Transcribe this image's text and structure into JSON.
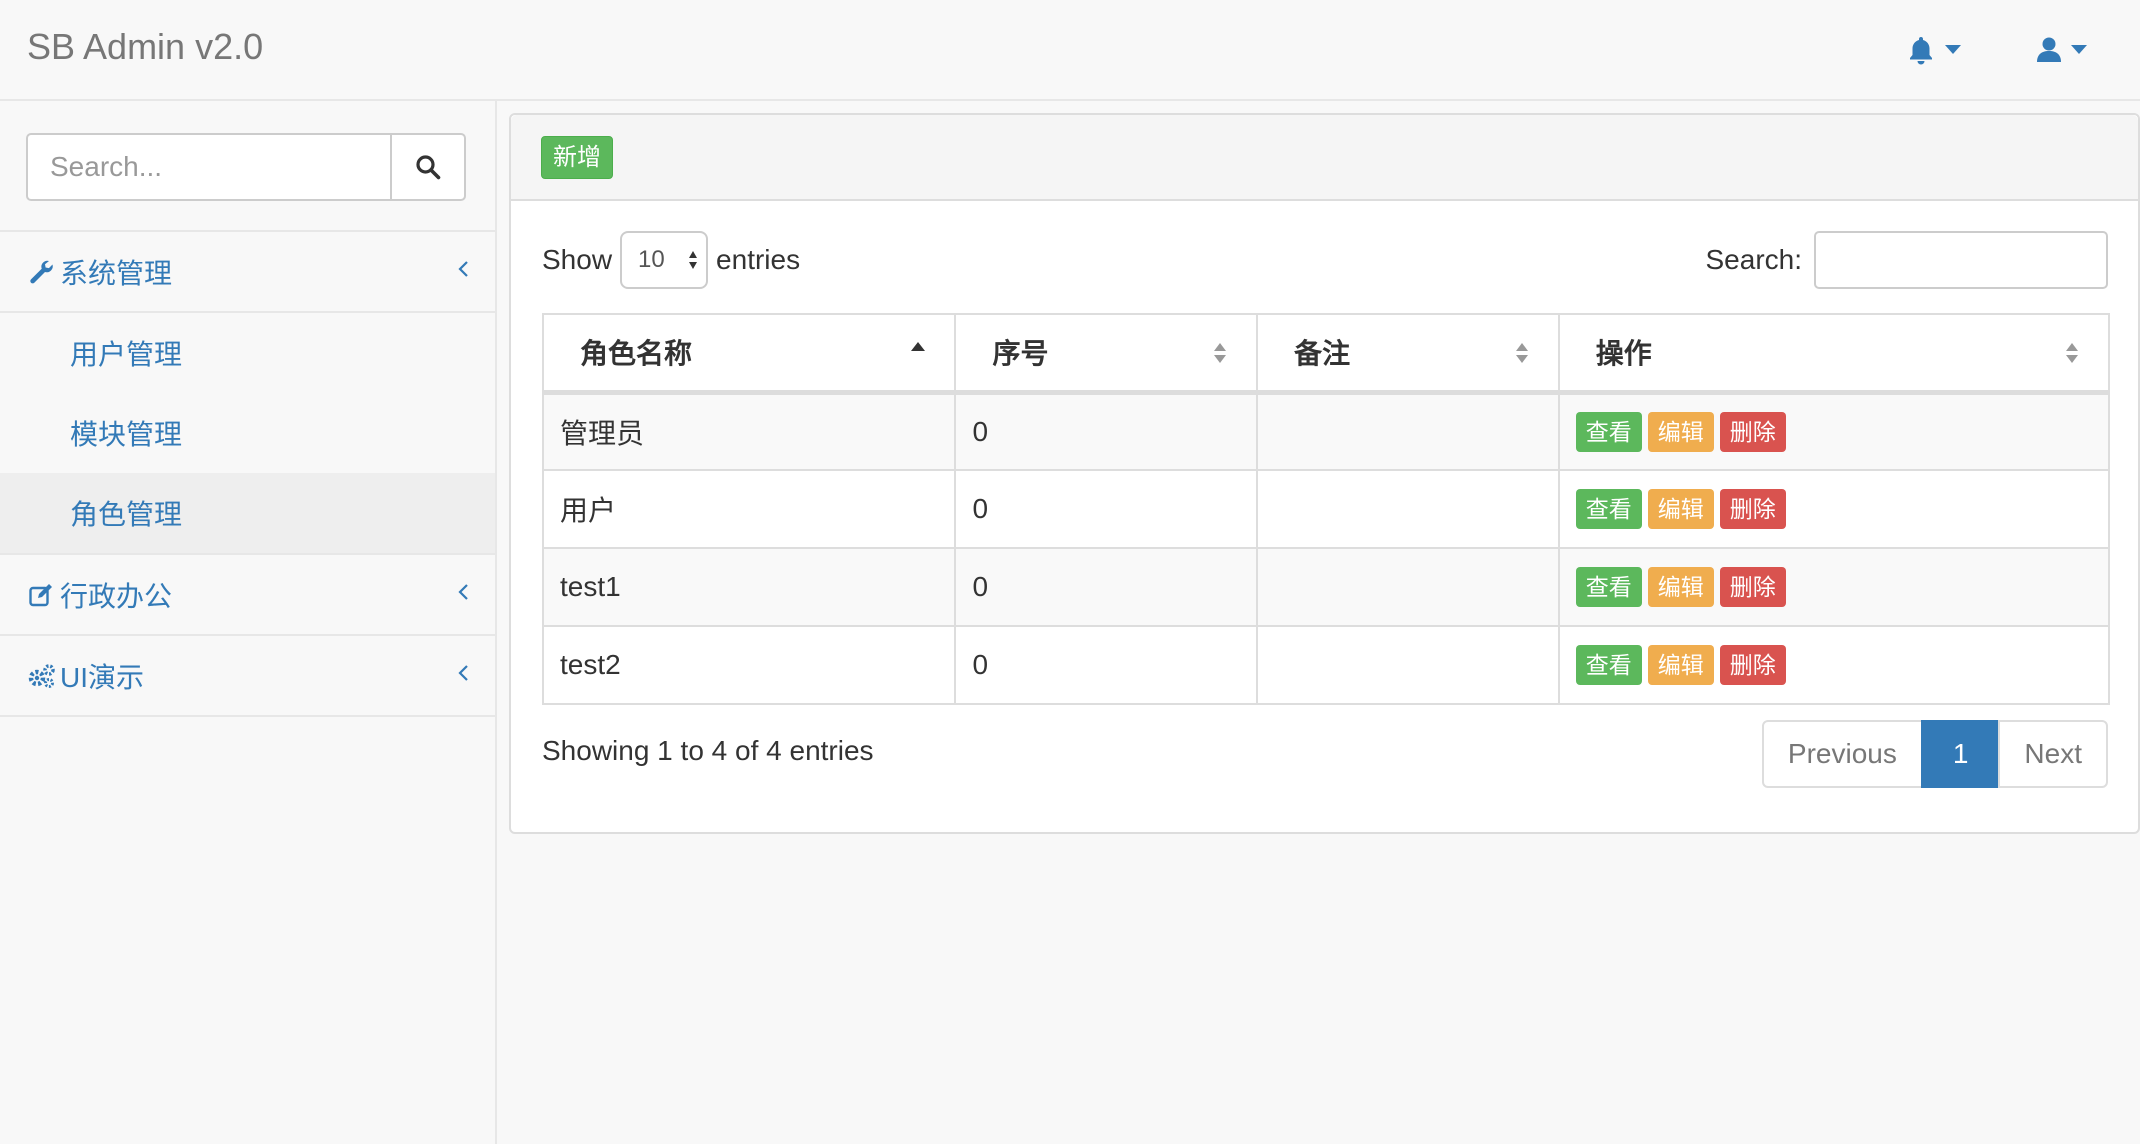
{
  "navbar": {
    "brand": "SB Admin v2.0",
    "alerts_icon": "bell-icon",
    "user_icon": "user-icon"
  },
  "sidebar": {
    "search_placeholder": "Search...",
    "groups": [
      {
        "label": "系统管理",
        "icon": "wrench-icon",
        "items": [
          {
            "label": "用户管理"
          },
          {
            "label": "模块管理"
          },
          {
            "label": "角色管理",
            "active": true
          }
        ]
      },
      {
        "label": "行政办公",
        "icon": "edit-icon"
      },
      {
        "label": "UI演示",
        "icon": "gears-icon"
      }
    ]
  },
  "panel": {
    "add_button": "新增",
    "length": {
      "prefix": "Show",
      "value": "10",
      "suffix": "entries"
    },
    "filter_label": "Search:",
    "columns": [
      "角色名称",
      "序号",
      "备注",
      "操作"
    ],
    "rows": [
      {
        "name": "管理员",
        "order": "0",
        "note": ""
      },
      {
        "name": "用户",
        "order": "0",
        "note": ""
      },
      {
        "name": "test1",
        "order": "0",
        "note": ""
      },
      {
        "name": "test2",
        "order": "0",
        "note": ""
      }
    ],
    "actions": {
      "view": "查看",
      "edit": "编辑",
      "delete": "删除"
    },
    "info": "Showing 1 to 4 of 4 entries",
    "pagination": {
      "previous": "Previous",
      "current": "1",
      "next": "Next"
    }
  },
  "colors": {
    "link": "#337ab7",
    "success": "#5cb85c",
    "warning": "#f0ad4e",
    "danger": "#d9534f"
  }
}
